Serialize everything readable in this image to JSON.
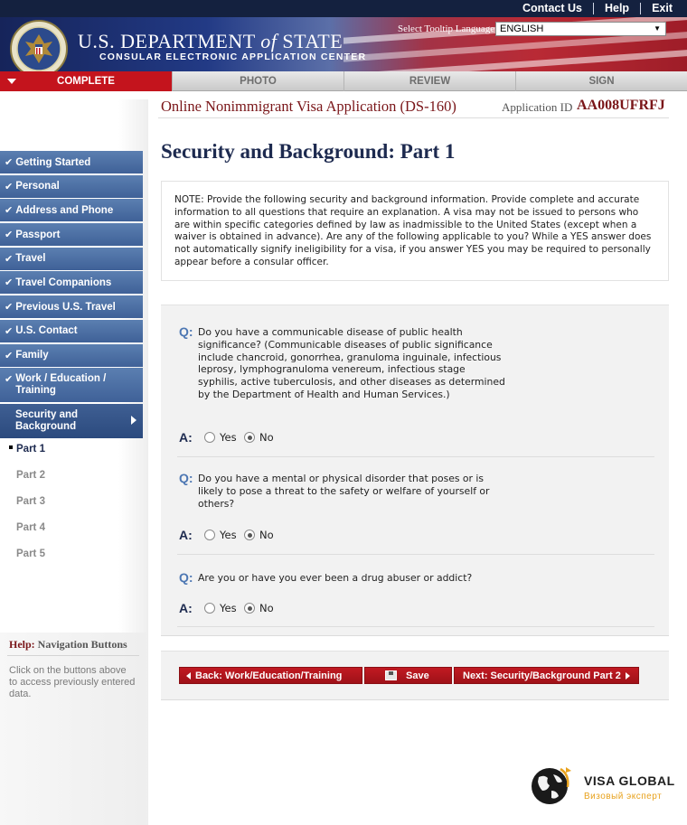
{
  "header": {
    "links": [
      "Contact Us",
      "Help",
      "Exit"
    ],
    "brand_title": "U.S. DEPARTMENT",
    "brand_of": "of",
    "brand_state": "STATE",
    "brand_subtitle": "CONSULAR ELECTRONIC APPLICATION CENTER",
    "tooltip_label": "Select Tooltip Language",
    "tooltip_value": "ENGLISH"
  },
  "tabs": [
    {
      "label": "COMPLETE",
      "active": true
    },
    {
      "label": "PHOTO",
      "active": false
    },
    {
      "label": "REVIEW",
      "active": false
    },
    {
      "label": "SIGN",
      "active": false
    }
  ],
  "form": {
    "name": "Online Nonimmigrant Visa Application (DS-160)",
    "app_id_label": "Application ID",
    "app_id": "AA008UFRFJ",
    "section_title": "Security and Background: Part 1"
  },
  "sidebar": {
    "items": [
      "Getting Started",
      "Personal",
      "Address and Phone",
      "Passport",
      "Travel",
      "Travel Companions",
      "Previous U.S. Travel",
      "U.S. Contact",
      "Family",
      "Work / Education / Training"
    ],
    "current": "Security and Background",
    "subitems": [
      "Part 1",
      "Part 2",
      "Part 3",
      "Part 4",
      "Part 5"
    ]
  },
  "help": {
    "title_prefix": "Help:",
    "title": "Navigation Buttons",
    "text": "Click on the buttons above to access previously entered data."
  },
  "note": "NOTE: Provide the following security and background information. Provide complete and accurate information to all questions that require an explanation. A visa may not be issued to persons who are within specific categories defined by law as inadmissible to the United States (except when a waiver is obtained in advance). Are any of the following applicable to you? While a YES answer does not automatically signify ineligibility for a visa, if you answer YES you may be required to personally appear before a consular officer.",
  "questions": [
    {
      "q_label": "Q:",
      "a_label": "A:",
      "text": "Do you have a communicable disease of public health significance? (Communicable diseases of public significance include chancroid, gonorrhea, granuloma inguinale, infectious leprosy, lymphogranuloma venereum, infectious stage syphilis, active tuberculosis, and other diseases as determined by the Department of Health and Human Services.)",
      "yes": "Yes",
      "no": "No",
      "selected": "No"
    },
    {
      "q_label": "Q:",
      "a_label": "A:",
      "text": "Do you have a mental or physical disorder that poses or is likely to pose a threat to the safety or welfare of yourself or others?",
      "yes": "Yes",
      "no": "No",
      "selected": "No"
    },
    {
      "q_label": "Q:",
      "a_label": "A:",
      "text": "Are you or have you ever been a drug abuser or addict?",
      "yes": "Yes",
      "no": "No",
      "selected": "No"
    }
  ],
  "buttons": {
    "back": "Back: Work/Education/Training",
    "save": "Save",
    "next": "Next: Security/Background Part 2"
  },
  "watermark": {
    "name": "VISA GLOBAL",
    "tagline": "Визовый эксперт"
  },
  "colors": {
    "accent_red": "#c4141d",
    "nav_blue": "#4a6ca3",
    "title_navy": "#1d2a4f",
    "dark_red_text": "#7a1619"
  }
}
